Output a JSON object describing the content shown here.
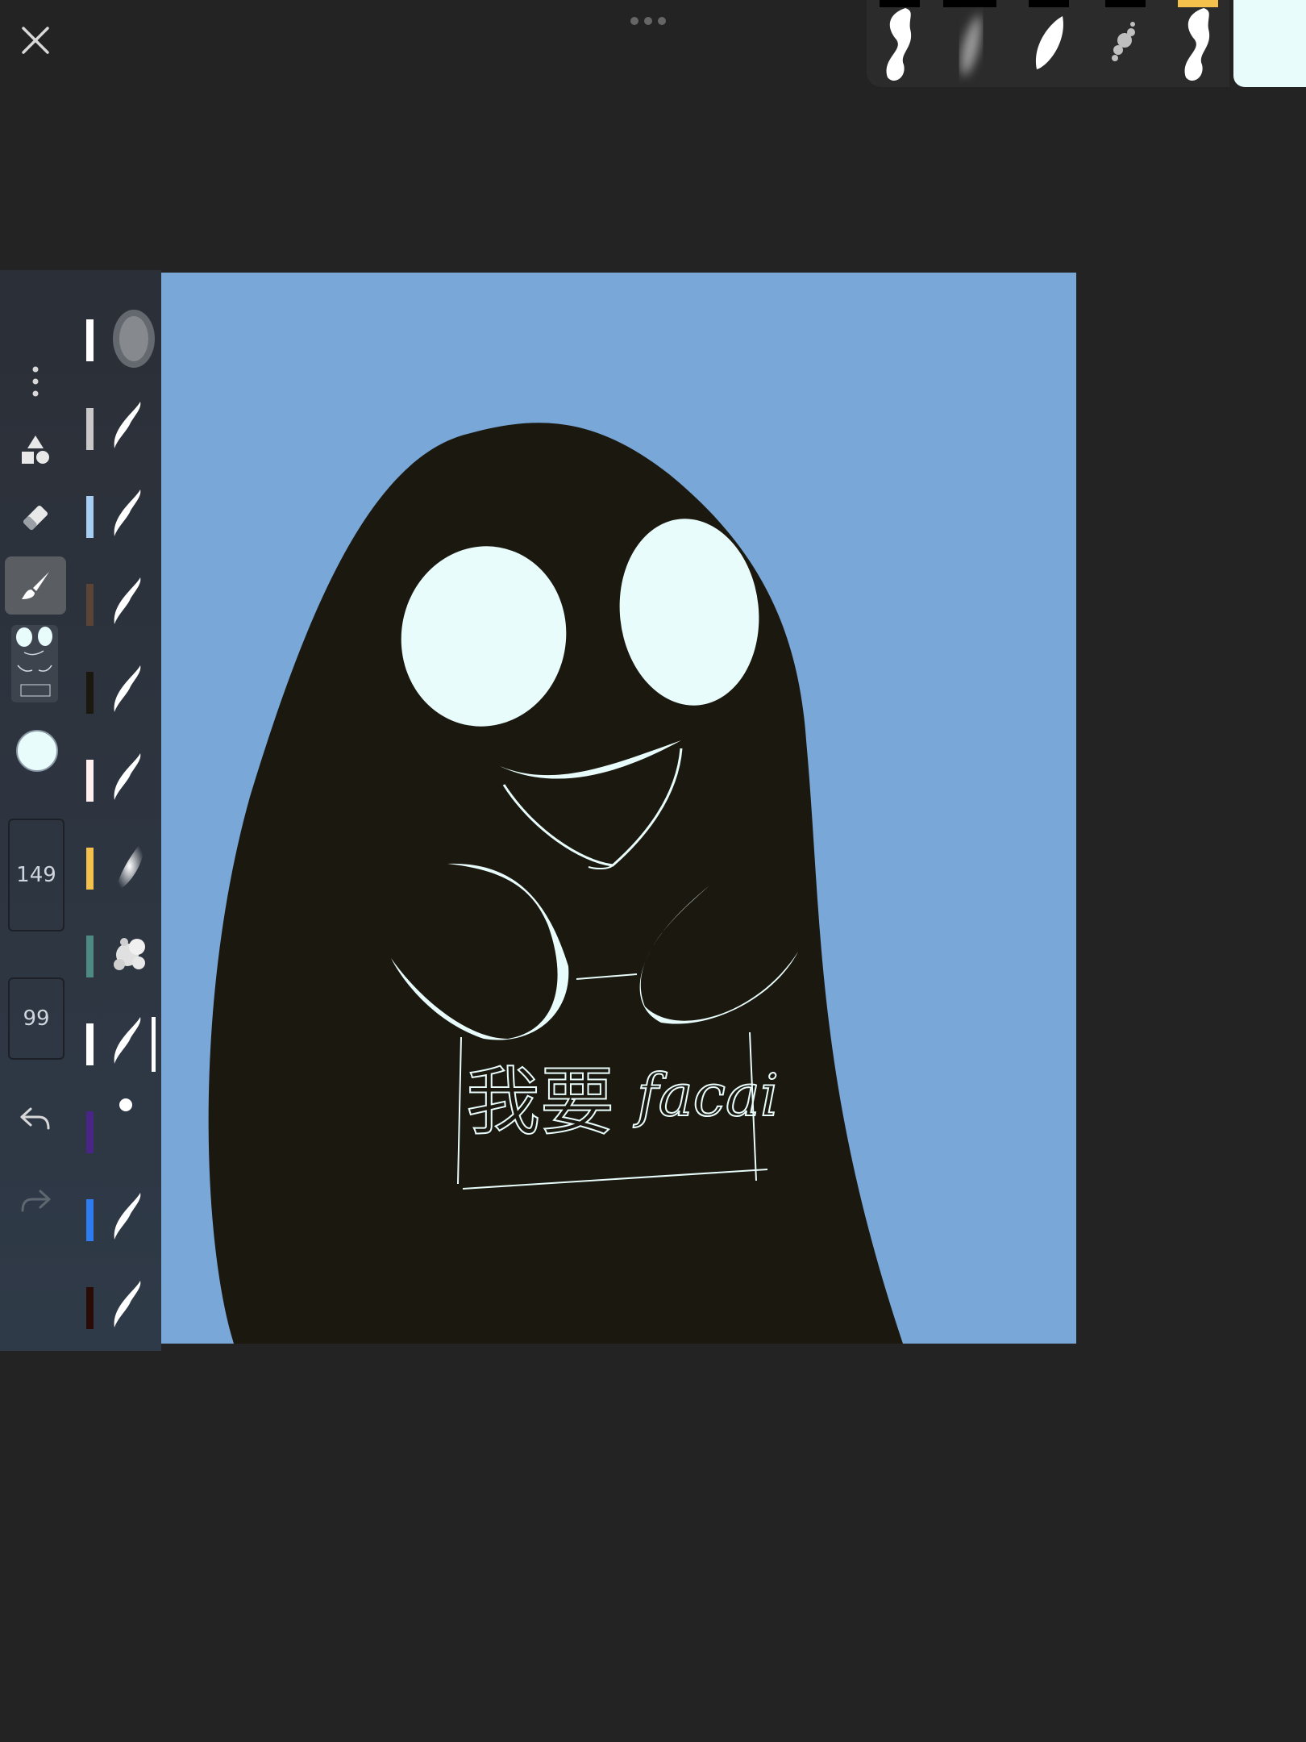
{
  "app": {
    "name": "drawing-app"
  },
  "toolbar": {
    "brush_size": "149",
    "brush_opacity": "99",
    "current_color": "#e8fcfc",
    "active_tool": "brush"
  },
  "icons": {
    "close": "close-icon",
    "more": "more-vertical-icon",
    "shapes": "shapes-icon",
    "eraser": "eraser-icon",
    "brush": "brush-icon",
    "undo": "undo-icon",
    "redo": "redo-icon",
    "menu": "more-horizontal-icon"
  },
  "brush_palette": [
    {
      "color": "#ffffff",
      "type": "texture"
    },
    {
      "color": "#c8c8c8",
      "type": "pen"
    },
    {
      "color": "#a6cdf2",
      "type": "pen"
    },
    {
      "color": "#5b4335",
      "type": "pen"
    },
    {
      "color": "#1b180f",
      "type": "pen"
    },
    {
      "color": "#fff0f0",
      "type": "pen"
    },
    {
      "color": "#f3c14c",
      "type": "airbrush"
    },
    {
      "color": "#4f8a82",
      "type": "splatter"
    },
    {
      "color": "#ffffff",
      "type": "pen",
      "selected": true
    },
    {
      "color": "#4a2585",
      "type": "dot"
    },
    {
      "color": "#2d7df0",
      "type": "pen"
    },
    {
      "color": "#2a0b06",
      "type": "pen"
    }
  ],
  "recent_brushes": [
    {
      "type": "pen",
      "active": false
    },
    {
      "type": "soft",
      "active": false
    },
    {
      "type": "pen-soft",
      "active": false
    },
    {
      "type": "splatter",
      "active": false
    },
    {
      "type": "pen",
      "active": true
    }
  ],
  "artwork": {
    "background": "#78a7d8",
    "figure_color": "#1b180f",
    "line_color": "#e8fcfc",
    "sign_text_cn": "我要",
    "sign_text_latin": "facai"
  }
}
